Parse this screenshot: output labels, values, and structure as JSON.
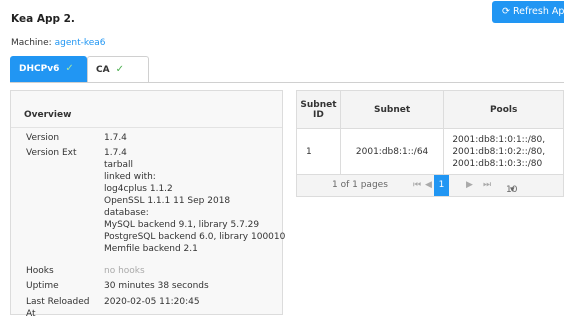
{
  "header": {
    "title": "Kea App 2.",
    "refresh_label": "Refresh App"
  },
  "machine": {
    "label": "Machine:",
    "link": "agent-kea6"
  },
  "tabs": [
    {
      "label": "DHCPv6",
      "status": "✓"
    },
    {
      "label": "CA",
      "status": "✓"
    }
  ],
  "overview": {
    "title": "Overview",
    "rows": {
      "version": {
        "label": "Version",
        "value": "1.7.4"
      },
      "version_ext": {
        "label": "Version Ext",
        "lines": [
          "1.7.4",
          "tarball",
          "linked with:",
          "log4cplus 1.1.2",
          "OpenSSL 1.1.1 11 Sep 2018",
          "database:",
          "MySQL backend 9.1, library 5.7.29",
          "PostgreSQL backend 6.0, library 100010",
          "Memfile backend 2.1"
        ]
      },
      "hooks": {
        "label": "Hooks",
        "value": "no hooks"
      },
      "uptime": {
        "label": "Uptime",
        "value": "30 minutes 38 seconds"
      },
      "last_reloaded": {
        "label": "Last Reloaded At",
        "value": "2020-02-05 11:20:45"
      }
    }
  },
  "subnets": {
    "headers": [
      "Subnet ID",
      "Subnet",
      "Pools"
    ],
    "rows": [
      {
        "id": "1",
        "subnet": "2001:db8:1::/64",
        "pools": [
          "2001:db8:1:0:1::/80,",
          "2001:db8:1:0:2::/80,",
          "2001:db8:1:0:3::/80"
        ]
      }
    ],
    "paginator": {
      "info": "1 of 1 pages",
      "first": "⏮",
      "prev": "◀",
      "current": "1",
      "next": "▶",
      "last": "⏭",
      "per_page": "10"
    }
  }
}
